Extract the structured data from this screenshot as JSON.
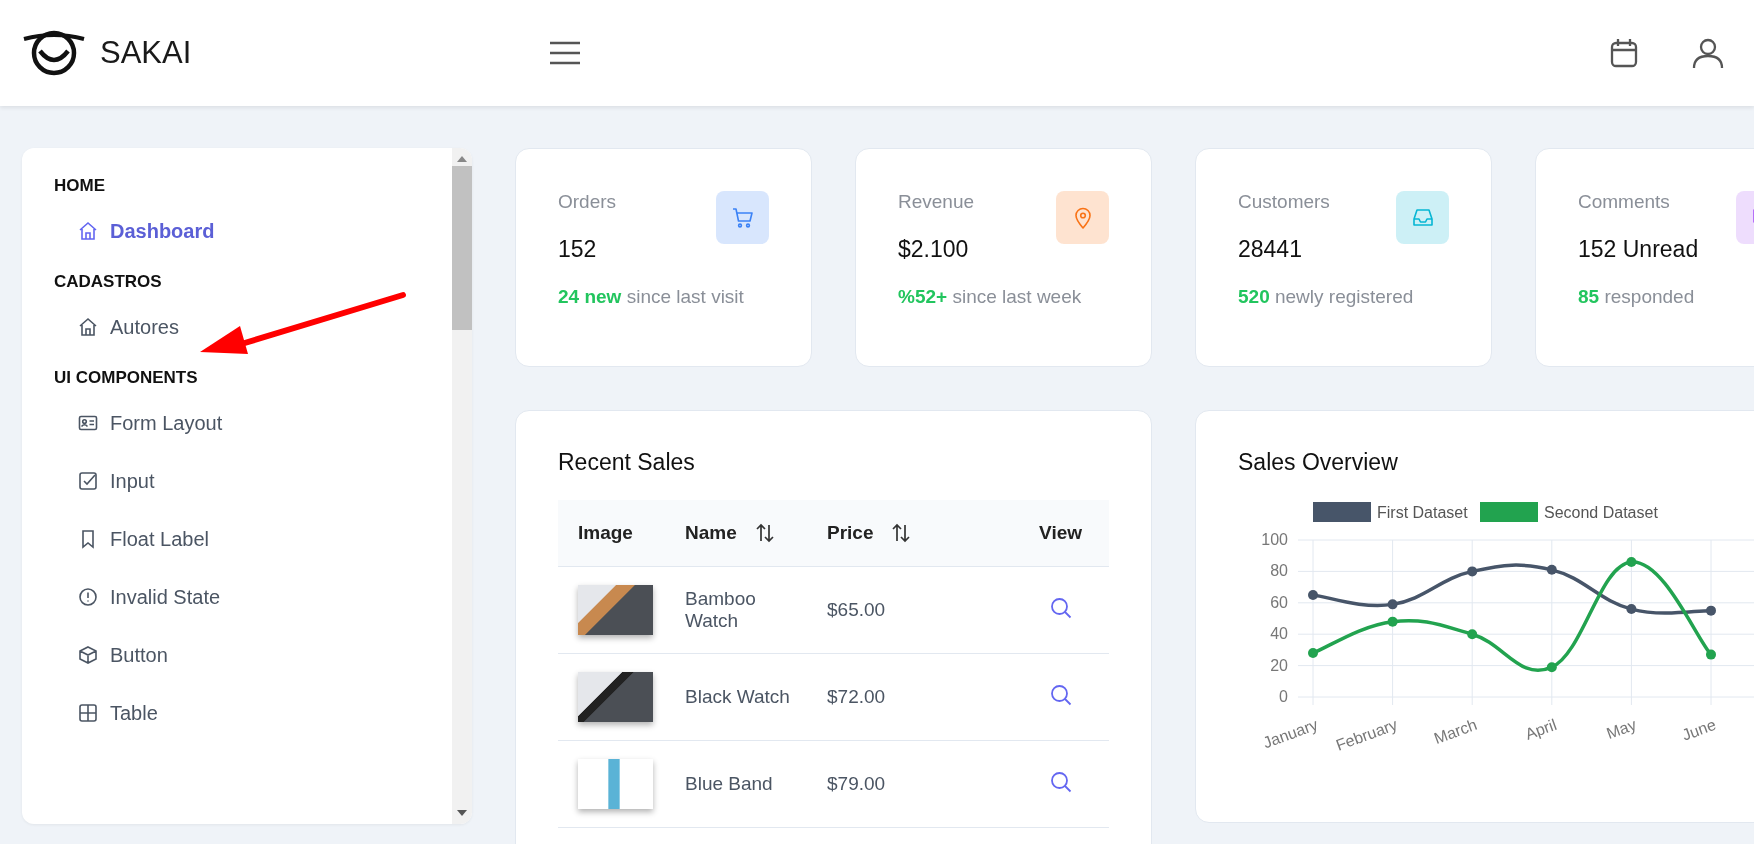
{
  "header": {
    "brand": "SAKAI"
  },
  "sidebar": {
    "sections": [
      {
        "title": "HOME",
        "items": [
          {
            "label": "Dashboard",
            "selected": true
          }
        ]
      },
      {
        "title": "CADASTROS",
        "items": [
          {
            "label": "Autores",
            "selected": false
          }
        ]
      },
      {
        "title": "UI COMPONENTS",
        "items": [
          {
            "label": "Form Layout",
            "selected": false
          },
          {
            "label": "Input",
            "selected": false
          },
          {
            "label": "Float Label",
            "selected": false
          },
          {
            "label": "Invalid State",
            "selected": false
          },
          {
            "label": "Button",
            "selected": false
          },
          {
            "label": "Table",
            "selected": false
          }
        ]
      }
    ]
  },
  "stats": [
    {
      "title": "Orders",
      "value": "152",
      "highlight": "24 new",
      "note": "since last visit"
    },
    {
      "title": "Revenue",
      "value": "$2.100",
      "highlight": "%52+",
      "note": "since last week"
    },
    {
      "title": "Customers",
      "value": "28441",
      "highlight": "520",
      "note": "newly registered"
    },
    {
      "title": "Comments",
      "value": "152 Unread",
      "highlight": "85",
      "note": "responded"
    }
  ],
  "recent_sales": {
    "title": "Recent Sales",
    "columns": [
      {
        "label": "Image",
        "sortable": false
      },
      {
        "label": "Name",
        "sortable": true
      },
      {
        "label": "Price",
        "sortable": true
      },
      {
        "label": "View",
        "sortable": false
      }
    ],
    "rows": [
      {
        "name": "Bamboo Watch",
        "price": "$65.00"
      },
      {
        "name": "Black Watch",
        "price": "$72.00"
      },
      {
        "name": "Blue Band",
        "price": "$79.00"
      }
    ]
  },
  "sales_overview": {
    "title": "Sales Overview",
    "chart_data": {
      "type": "line",
      "categories": [
        "January",
        "February",
        "March",
        "April",
        "May",
        "June"
      ],
      "ylim": [
        0,
        100
      ],
      "yticks": [
        0,
        20,
        40,
        60,
        80,
        100
      ],
      "grid": true,
      "legend": true,
      "series": [
        {
          "name": "First Dataset",
          "color": "#475569",
          "marker": true,
          "values": [
            65,
            59,
            80,
            81,
            56,
            55
          ]
        },
        {
          "name": "Second Dataset",
          "color": "#22a34f",
          "marker": true,
          "values": [
            28,
            48,
            40,
            19,
            86,
            27
          ]
        }
      ]
    }
  },
  "annotation": {
    "kind": "arrow",
    "color": "#ff0000"
  }
}
